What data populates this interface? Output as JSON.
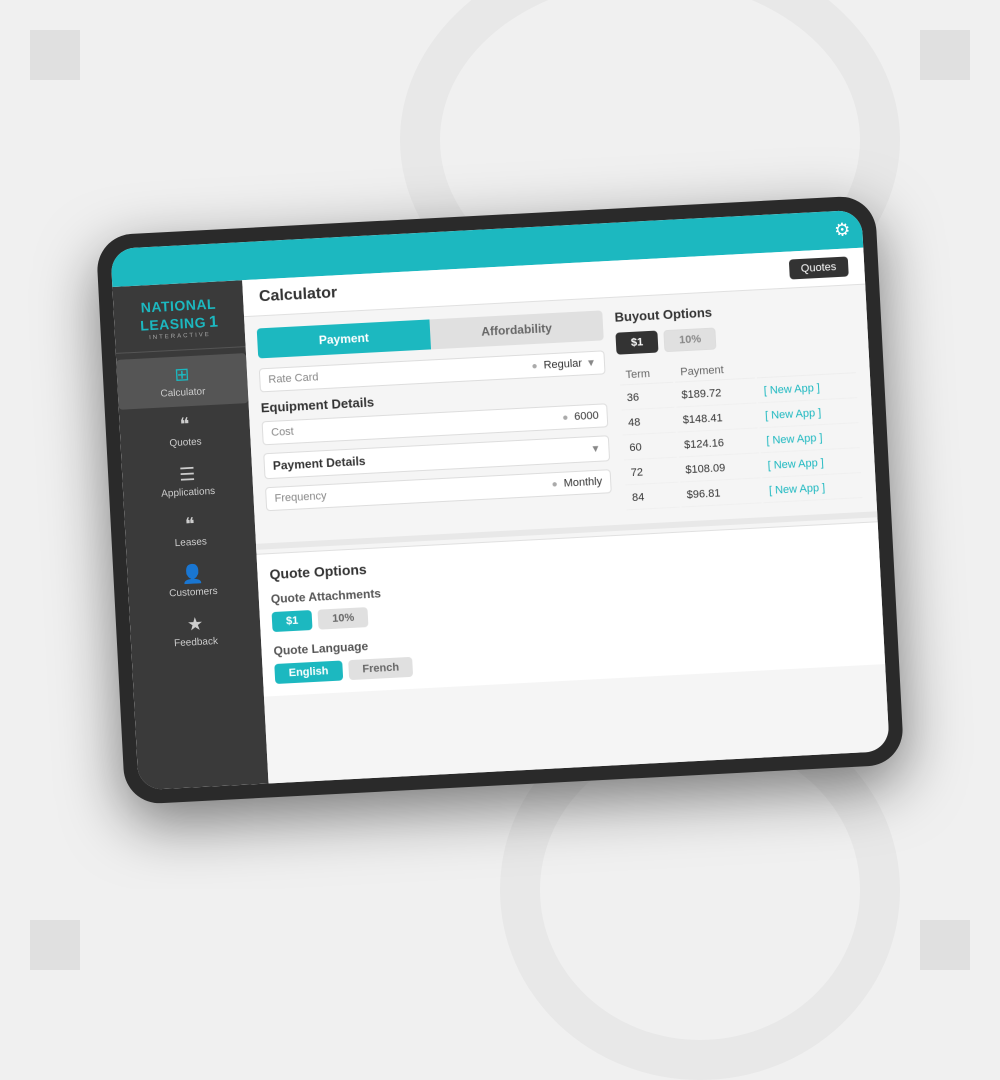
{
  "background": {
    "corners": [
      "top-left",
      "top-right",
      "bottom-left",
      "bottom-right"
    ]
  },
  "app": {
    "title": "National Leasing Interactive",
    "logo_line1": "NATIONAL LEASING",
    "logo_number": "1",
    "logo_subtitle": "INTERACTIVE",
    "settings_icon": "⚙"
  },
  "header": {
    "page_title": "Calculator",
    "quotes_button": "Quotes"
  },
  "sidebar": {
    "items": [
      {
        "id": "calculator",
        "label": "Calculator",
        "icon": "⊞",
        "active": true
      },
      {
        "id": "quotes",
        "label": "Quotes",
        "icon": "❝",
        "active": false
      },
      {
        "id": "applications",
        "label": "Applications",
        "icon": "☰",
        "active": false
      },
      {
        "id": "leases",
        "label": "Leases",
        "icon": "❝",
        "active": false
      },
      {
        "id": "customers",
        "label": "Customers",
        "icon": "👤",
        "active": false
      },
      {
        "id": "feedback",
        "label": "Feedback",
        "icon": "★",
        "active": false
      }
    ]
  },
  "calculator": {
    "tabs": [
      {
        "id": "payment",
        "label": "Payment",
        "active": true
      },
      {
        "id": "affordability",
        "label": "Affordability",
        "active": false
      }
    ],
    "rate_card": {
      "label": "Rate Card",
      "value": "Regular"
    },
    "equipment_details": {
      "title": "Equipment Details",
      "cost_label": "Cost",
      "cost_value": "6000"
    },
    "payment_details": {
      "title": "Payment Details",
      "frequency_label": "Frequency",
      "frequency_value": "Monthly"
    }
  },
  "buyout_options": {
    "title": "Buyout Options",
    "buttons": [
      {
        "label": "$1",
        "active": true
      },
      {
        "label": "10%",
        "active": false
      }
    ],
    "table": {
      "columns": [
        "Term",
        "Payment"
      ],
      "rows": [
        {
          "term": "36",
          "payment": "$189.72",
          "link": "[ New App ]"
        },
        {
          "term": "48",
          "payment": "$148.41",
          "link": "[ New App ]"
        },
        {
          "term": "60",
          "payment": "$124.16",
          "link": "[ New App ]"
        },
        {
          "term": "72",
          "payment": "$108.09",
          "link": "[ New App ]"
        },
        {
          "term": "84",
          "payment": "$96.81",
          "link": "[ New App ]"
        }
      ]
    }
  },
  "quote_options": {
    "title": "Quote Options",
    "attachments": {
      "title": "Quote Attachments",
      "buttons": [
        {
          "label": "$1",
          "active": true
        },
        {
          "label": "10%",
          "active": false
        }
      ]
    },
    "language": {
      "title": "Quote Language",
      "buttons": [
        {
          "label": "English",
          "active": true
        },
        {
          "label": "French",
          "active": false
        }
      ]
    }
  }
}
